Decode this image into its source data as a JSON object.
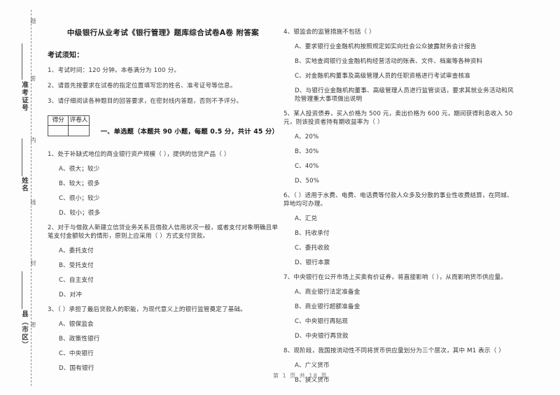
{
  "document": {
    "title": "中级银行从业考试《银行管理》题库综合试卷A卷 附答案",
    "notice_heading": "考试须知：",
    "notices": [
      "1、考试时间：120 分钟。本卷满分为 100 分。",
      "2、请首先按要求在试卷的指定位置填写您的姓名、准考证号等信息。",
      "3、请仔细阅读各种题目的回答要求，在密封线内答题，否则不予评分。"
    ],
    "footer": "第 1 页 共 18 页"
  },
  "seal_margin": {
    "labels": [
      "准考证号",
      "姓名",
      "县（市区）"
    ],
    "vertical_chars": [
      "题",
      "答",
      "内",
      "线",
      "封",
      "密"
    ]
  },
  "score_table": {
    "headers": [
      "得分",
      "评卷人"
    ],
    "values": [
      "",
      ""
    ]
  },
  "section": {
    "heading": "一、单选题（本题共 90 小题，每题 0.5 分，共计 45 分）"
  },
  "questions": [
    {
      "number": "1、",
      "stem": "处于补缺式地位的商业银行资产规模（      ），提供的信贷产品（      ）",
      "options": [
        "A、很大；较少",
        "B、较大；很多",
        "C、很小；较少",
        "D、较小；很多"
      ]
    },
    {
      "number": "2、",
      "stem": "对于与借款人新建立信贷业务关系且借款人信用状况一般，或者支付对象明确且单笔支付金额较大的情形，原则上应采用（      ）方式支付贷款。",
      "options": [
        "A、委托支付",
        "B、受托支付",
        "C、自主支付",
        "D、对冲"
      ]
    },
    {
      "number": "3、",
      "stem": "（      ）承担了最后贷款人的职能，为现代意义上的银行监管奠定了基础。",
      "options": [
        "A、银保监会",
        "B、政策性银行",
        "C、中央银行",
        "D、国有银行"
      ]
    },
    {
      "number": "4、",
      "stem": "银监会的监管措施不包括（      ）",
      "options": [
        "A、要求银行业金融机构按照规定如实向社会公众披露财务会计报告",
        "B、实地查阅银行业金融机构经营活动的账表、文件、档案等各种资料",
        "C、对金融机构董事及高级管理人员的任职资格进行考试审查核准",
        "D、与银行业金融机构董事、高级管理人员进行监管谈话，要求其就业务活动和风险管理重大事项做出说明"
      ]
    },
    {
      "number": "5、",
      "stem": "某人投资债券，买入价格为 500 元，卖出价格为 600 元，期间获得利息收入 50 元，则该投资者持有期收益率为（      ）",
      "options": [
        "A、20%",
        "B、30%",
        "C、40%",
        "D、50%"
      ]
    },
    {
      "number": "6、",
      "stem": "（      ）适用于水费、电费、电话费等付款人众多及分散的事业性收费结算，在同城、异地均可办理。",
      "options": [
        "A、汇兑",
        "B、托收承付",
        "C、委托收款",
        "D、银行本票"
      ]
    },
    {
      "number": "7、",
      "stem": "中央银行在公开市场上买卖有价证券，将直接影响（      ），从而影响货币供应量。",
      "options": [
        "A、商业银行法定准备金",
        "B、商业银行超额准备金",
        "C、中央银行再贴现",
        "D、中央银行再贷款"
      ]
    },
    {
      "number": "8、",
      "stem": "现阶段，我国按流动性不同将货币供应量划分为三个层次，其中 M1 表示（      ）",
      "options": [
        "A、广义货币",
        "B、狭义货币"
      ]
    }
  ]
}
